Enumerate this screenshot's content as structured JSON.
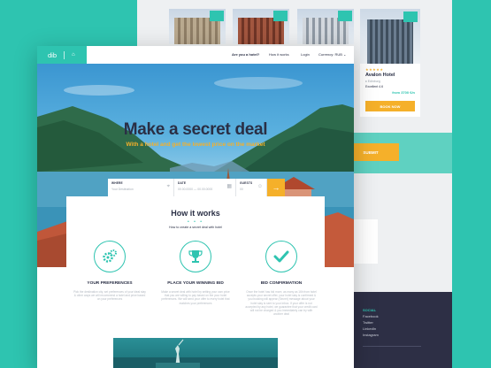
{
  "back_page": {
    "hotel_card": {
      "stars": "★★★★★",
      "name": "Avalon Hotel",
      "location": "♦ Edinburg",
      "rating": "Excellent 4.6",
      "price": "from 3700 €/n",
      "book_label": "BOOK NOW"
    },
    "submit_label": "SUBMIT",
    "footer": {
      "social_title": "SOCIAL",
      "links": [
        "Facebook",
        "Twitter",
        "LinkedIn",
        "Instagram"
      ]
    }
  },
  "nav": {
    "logo": "dib",
    "items": [
      "Are you a hotel?",
      "How it works",
      "Login",
      "Currency: RUB ⌄"
    ]
  },
  "hero": {
    "title": "Make a secret deal",
    "subtitle": "With a hotel and get the lowest price on the market"
  },
  "search": {
    "where_label": "WHERE",
    "where_placeholder": "Your Destination",
    "date_label": "DATE",
    "date_value": "00.00.0000 — 00.00.0000",
    "guests_label": "GUESTS",
    "guests_value": "00"
  },
  "how_it_works": {
    "title": "How it works",
    "dots": "• • •",
    "subtitle": "How to create a secret deal with hotel",
    "steps": [
      {
        "icon": "gears-icon",
        "title": "YOUR PREFERENCES",
        "desc": "Pick the destination city, set preferences of your ideal stay & other ways we will recommend a hotel and price based on your preferences"
      },
      {
        "icon": "trophy-icon",
        "title": "PLACE YOUR WINNING BID",
        "desc": "Make a secret deal with hotel by setting your own price that you are willing to pay based on the your hotel preferences. We will send your offer to every hotel that matches your preferences"
      },
      {
        "icon": "checkmark-icon",
        "title": "BID CONFIRMATION",
        "desc": "Once the hotel has bid more, as many as 16h from hotel accepts your secret offer, your hotel stay is confirmed & you booking will appear (Secret) message about your hotel stay is sent to your inbox. If your offer is not accepted by any hotel, we guarantee that your credit card will not be charged & you immediately can try with another deal"
      }
    ]
  },
  "colors": {
    "teal": "#2ec4b0",
    "navy": "#2a2f45",
    "yellow": "#f5b02a",
    "footer": "#2d2f45"
  }
}
